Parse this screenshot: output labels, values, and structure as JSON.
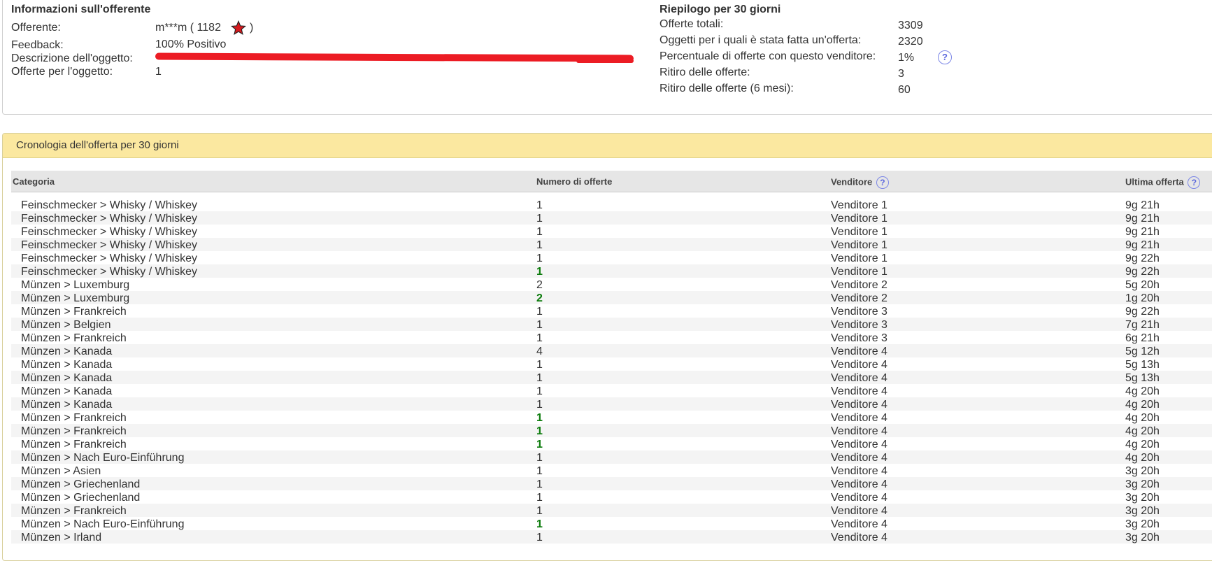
{
  "bidder_info": {
    "title": "Informazioni sull'offerente",
    "bidder_label": "Offerente:",
    "bidder_name": "m***m ( 1182",
    "bidder_close": ")",
    "feedback_label": "Feedback:",
    "feedback_value": "100% Positivo",
    "description_label": "Descrizione dell'oggetto:",
    "item_bids_label": "Offerte per l'oggetto:",
    "item_bids_value": "1"
  },
  "summary": {
    "title": "Riepilogo per 30 giorni",
    "rows": [
      {
        "label": "Offerte totali:",
        "value": "3309"
      },
      {
        "label": "Oggetti per i quali è stata fatta un'offerta:",
        "value": "2320"
      },
      {
        "label": "Percentuale di offerte con questo venditore:",
        "value": "1%"
      },
      {
        "label": "Ritiro delle offerte:",
        "value": "3"
      },
      {
        "label": "Ritiro delle offerte (6 mesi):",
        "value": "60"
      }
    ]
  },
  "history": {
    "title": "Cronologia dell'offerta per 30 giorni",
    "columns": {
      "category": "Categoria",
      "bids": "Numero di offerte",
      "seller": "Venditore",
      "last_bid": "Ultima offerta"
    },
    "rows": [
      {
        "category": "Feinschmecker > Whisky / Whiskey",
        "bids": "1",
        "seller": "Venditore 1",
        "last": "9g 21h",
        "hl": false
      },
      {
        "category": "Feinschmecker > Whisky / Whiskey",
        "bids": "1",
        "seller": "Venditore 1",
        "last": "9g 21h",
        "hl": false
      },
      {
        "category": "Feinschmecker > Whisky / Whiskey",
        "bids": "1",
        "seller": "Venditore 1",
        "last": "9g 21h",
        "hl": false
      },
      {
        "category": "Feinschmecker > Whisky / Whiskey",
        "bids": "1",
        "seller": "Venditore 1",
        "last": "9g 21h",
        "hl": false
      },
      {
        "category": "Feinschmecker > Whisky / Whiskey",
        "bids": "1",
        "seller": "Venditore 1",
        "last": "9g 22h",
        "hl": false
      },
      {
        "category": "Feinschmecker > Whisky / Whiskey",
        "bids": "1",
        "seller": "Venditore 1",
        "last": "9g 22h",
        "hl": true
      },
      {
        "category": "Münzen > Luxemburg",
        "bids": "2",
        "seller": "Venditore 2",
        "last": "5g 20h",
        "hl": false
      },
      {
        "category": "Münzen > Luxemburg",
        "bids": "2",
        "seller": "Venditore 2",
        "last": "1g 20h",
        "hl": true
      },
      {
        "category": "Münzen > Frankreich",
        "bids": "1",
        "seller": "Venditore 3",
        "last": "9g 22h",
        "hl": false
      },
      {
        "category": "Münzen > Belgien",
        "bids": "1",
        "seller": "Venditore 3",
        "last": "7g 21h",
        "hl": false
      },
      {
        "category": "Münzen > Frankreich",
        "bids": "1",
        "seller": "Venditore 3",
        "last": "6g 21h",
        "hl": false
      },
      {
        "category": "Münzen > Kanada",
        "bids": "4",
        "seller": "Venditore 4",
        "last": "5g 12h",
        "hl": false
      },
      {
        "category": "Münzen > Kanada",
        "bids": "1",
        "seller": "Venditore 4",
        "last": "5g 13h",
        "hl": false
      },
      {
        "category": "Münzen > Kanada",
        "bids": "1",
        "seller": "Venditore 4",
        "last": "5g 13h",
        "hl": false
      },
      {
        "category": "Münzen > Kanada",
        "bids": "1",
        "seller": "Venditore 4",
        "last": "4g 20h",
        "hl": false
      },
      {
        "category": "Münzen > Kanada",
        "bids": "1",
        "seller": "Venditore 4",
        "last": "4g 20h",
        "hl": false
      },
      {
        "category": "Münzen > Frankreich",
        "bids": "1",
        "seller": "Venditore 4",
        "last": "4g 20h",
        "hl": true
      },
      {
        "category": "Münzen > Frankreich",
        "bids": "1",
        "seller": "Venditore 4",
        "last": "4g 20h",
        "hl": true
      },
      {
        "category": "Münzen > Frankreich",
        "bids": "1",
        "seller": "Venditore 4",
        "last": "4g 20h",
        "hl": true
      },
      {
        "category": "Münzen > Nach Euro-Einführung",
        "bids": "1",
        "seller": "Venditore 4",
        "last": "4g 20h",
        "hl": false
      },
      {
        "category": "Münzen > Asien",
        "bids": "1",
        "seller": "Venditore 4",
        "last": "3g 20h",
        "hl": false
      },
      {
        "category": "Münzen > Griechenland",
        "bids": "1",
        "seller": "Venditore 4",
        "last": "3g 20h",
        "hl": false
      },
      {
        "category": "Münzen > Griechenland",
        "bids": "1",
        "seller": "Venditore 4",
        "last": "3g 20h",
        "hl": false
      },
      {
        "category": "Münzen > Frankreich",
        "bids": "1",
        "seller": "Venditore 4",
        "last": "3g 20h",
        "hl": false
      },
      {
        "category": "Münzen > Nach Euro-Einführung",
        "bids": "1",
        "seller": "Venditore 4",
        "last": "3g 20h",
        "hl": true
      },
      {
        "category": "Münzen > Irland",
        "bids": "1",
        "seller": "Venditore 4",
        "last": "3g 20h",
        "hl": false
      }
    ]
  },
  "icons": {
    "help": "?",
    "star_color": "#d6191e"
  }
}
